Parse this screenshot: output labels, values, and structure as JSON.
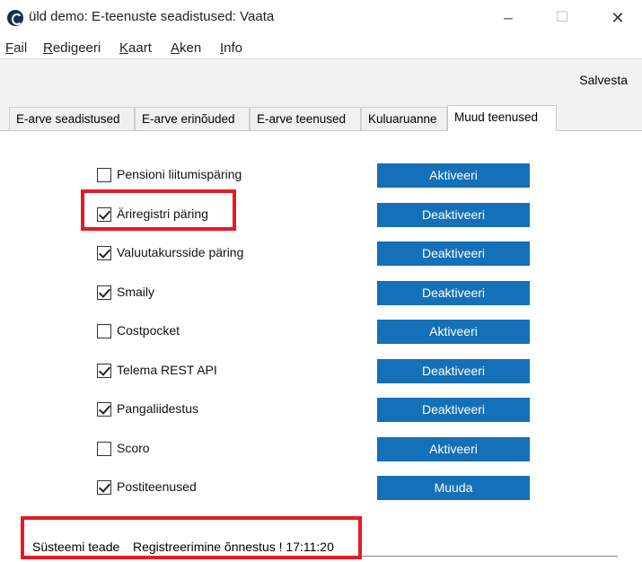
{
  "window": {
    "title": "üld demo: E-teenuste seadistused: Vaata",
    "min_symbol": "─",
    "max_symbol": "☐",
    "close_symbol": "✕"
  },
  "menu": [
    {
      "acc": "F",
      "rest": "ail"
    },
    {
      "acc": "R",
      "rest": "edigeeri"
    },
    {
      "acc": "K",
      "rest": "aart"
    },
    {
      "acc": "A",
      "rest": "ken"
    },
    {
      "acc": "I",
      "rest": "nfo"
    }
  ],
  "toolbar": {
    "save_label": "Salvesta"
  },
  "tabs": [
    {
      "label": "E-arve seadistused"
    },
    {
      "label": "E-arve erinõuded"
    },
    {
      "label": "E-arve teenused"
    },
    {
      "label": "Kuluaruanne"
    },
    {
      "label": "Muud teenused",
      "active": true
    }
  ],
  "services": [
    {
      "label": "Pensioni liitumispäring",
      "checked": false,
      "button": "Aktiveeri"
    },
    {
      "label": "Äriregistri päring",
      "checked": true,
      "button": "Deaktiveeri"
    },
    {
      "label": "Valuutakursside päring",
      "checked": true,
      "button": "Deaktiveeri"
    },
    {
      "label": "Smaily",
      "checked": true,
      "button": "Deaktiveeri"
    },
    {
      "label": "Costpocket",
      "checked": false,
      "button": "Aktiveeri"
    },
    {
      "label": "Telema REST API",
      "checked": true,
      "button": "Deaktiveeri"
    },
    {
      "label": "Pangaliidestus",
      "checked": true,
      "button": "Deaktiveeri"
    },
    {
      "label": "Scoro",
      "checked": false,
      "button": "Aktiveeri"
    },
    {
      "label": "Postiteenused",
      "checked": true,
      "button": "Muuda"
    }
  ],
  "status": {
    "label": "Süsteemi teade",
    "message": "Registreerimine õnnestus ! 17:11:20"
  },
  "colors": {
    "button_bg": "#1470b8",
    "highlight": "#e31b23"
  }
}
